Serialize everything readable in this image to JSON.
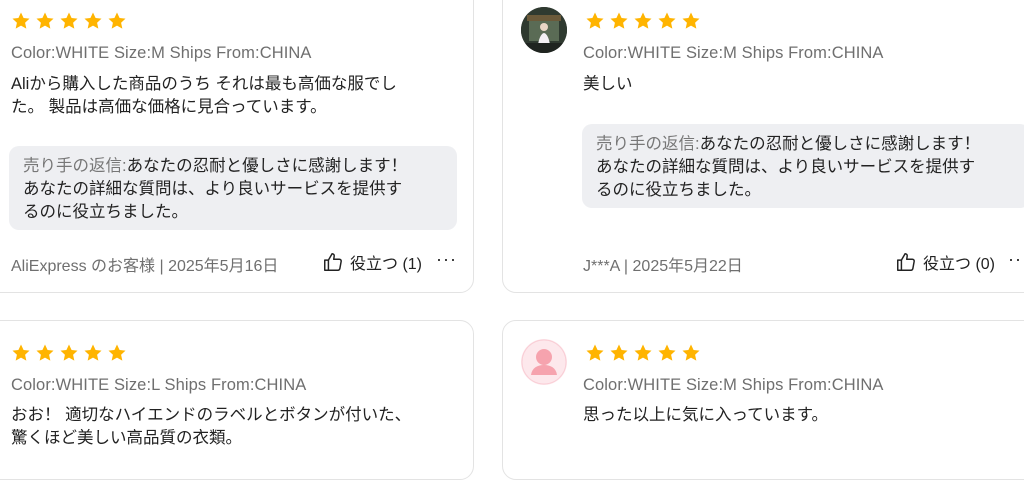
{
  "reviews": [
    {
      "rating": 5,
      "sku": "Color:WHITE Size:M Ships From:CHINA",
      "text_line1": "Aliから購入した商品のうち それは最も高価な服でし",
      "text_line2": "た。 製品は高価な価格に見合っています。",
      "reply_label": "売り手の返信:",
      "reply_line1": "あなたの忍耐と優しさに感謝します！",
      "reply_line2": "あなたの詳細な質問は、より良いサービスを提供す",
      "reply_line3": "るのに役立ちました。",
      "author_date": "AliExpress のお客様 | 2025年5月16日",
      "helpful": "役立つ (1)",
      "more": "···"
    },
    {
      "rating": 5,
      "sku": "Color:WHITE Size:M Ships From:CHINA",
      "text_line1": "美しい",
      "reply_label": "売り手の返信:",
      "reply_line1": "あなたの忍耐と優しさに感謝します！",
      "reply_line2": "あなたの詳細な質問は、より良いサービスを提供す",
      "reply_line3": "るのに役立ちました。",
      "author_date": "J***A | 2025年5月22日",
      "helpful": "役立つ (0)",
      "more": "···"
    },
    {
      "rating": 5,
      "sku": "Color:WHITE Size:L Ships From:CHINA",
      "text_line1": "おお！ 適切なハイエンドのラベルとボタンが付いた、",
      "text_line2": "驚くほど美しい高品質の衣類。"
    },
    {
      "rating": 5,
      "sku": "Color:WHITE Size:M Ships From:CHINA",
      "text_line1": "思った以上に気に入っています。"
    }
  ],
  "colors": {
    "star": "#FFB400",
    "reply_bg": "#EEEFF2",
    "avatar_default": "#F6A3AE"
  },
  "icons": {
    "star": "star-icon",
    "helpful": "thumbs-up-icon",
    "more": "more-icon",
    "avatar": "avatar-icon"
  }
}
